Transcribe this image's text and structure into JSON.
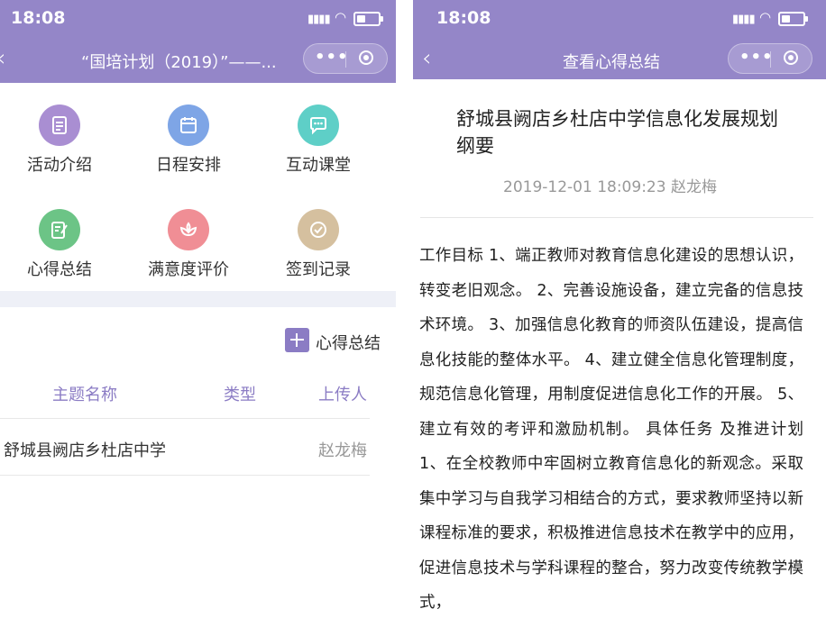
{
  "left": {
    "status": {
      "time": "18:08"
    },
    "nav": {
      "title": "“国培计划（2019）”——..."
    },
    "menu": [
      {
        "label": "活动介绍",
        "icon": "document-icon",
        "color": "#a98ed2"
      },
      {
        "label": "日程安排",
        "icon": "calendar-icon",
        "color": "#7ea5e6"
      },
      {
        "label": "互动课堂",
        "icon": "chat-bubble-icon",
        "color": "#5ecfc7"
      },
      {
        "label": "心得总结",
        "icon": "notepad-edit-icon",
        "color": "#6cc486"
      },
      {
        "label": "满意度评价",
        "icon": "flower-icon",
        "color": "#f08e95"
      },
      {
        "label": "签到记录",
        "icon": "checkmark-circle-icon",
        "color": "#d5c09f"
      }
    ],
    "add_button_label": "心得总结",
    "table": {
      "headers": [
        "主题名称",
        "类型",
        "上传人"
      ],
      "rows": [
        {
          "title": "舒城县阙店乡杜店中学",
          "type": "",
          "uploader": "赵龙梅"
        }
      ]
    }
  },
  "right": {
    "status": {
      "time": "18:08"
    },
    "nav": {
      "title": "查看心得总结"
    },
    "article": {
      "title": "舒城县阙店乡杜店中学信息化发展规划纲要",
      "date": "2019-12-01 18:09:23",
      "author": "赵龙梅",
      "body": "工作目标 1、端正教师对教育信息化建设的思想认识，转变老旧观念。 2、完善设施设备，建立完备的信息技术环境。 3、加强信息化教育的师资队伍建设，提高信息化技能的整体水平。 4、建立健全信息化管理制度，规范信息化管理，用制度促进信息化工作的开展。 5、建立有效的考评和激励机制。 具体任务 及推进计划 1、在全校教师中牢固树立教育信息化的新观念。采取集中学习与自我学习相结合的方式，要求教师坚持以新课程标准的要求，积极推进信息技术在教学中的应用，促进信息技术与学科课程的整合，努力改变传统教学模式，"
    }
  }
}
